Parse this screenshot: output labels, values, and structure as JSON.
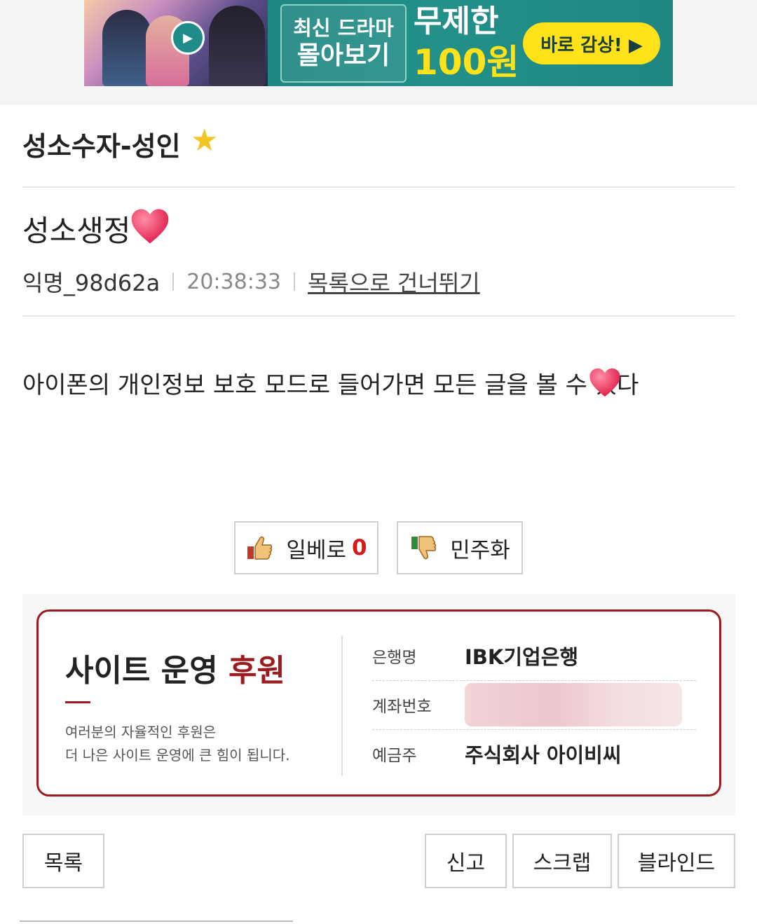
{
  "banner": {
    "line1": "최신 드라마",
    "line2": "몰아보기",
    "headline": "무제한",
    "price": "100원",
    "cta": "바로 감상! ▶"
  },
  "board": {
    "title": "성소수자-성인",
    "star_icon": "star-icon"
  },
  "post": {
    "title": "성소생정",
    "author": "익명_98d62a",
    "time": "20:38:33",
    "skip_link": "목록으로 건너뛰기",
    "body": "아이폰의 개인정보 보호 모드로 들어가면 모든 글을 볼 수 있다"
  },
  "votes": {
    "up_label": "일베로",
    "up_count": "0",
    "down_label": "민주화"
  },
  "support": {
    "title_main": "사이트 운영",
    "title_accent": "후원",
    "desc_line1": "여러분의 자율적인 후원은",
    "desc_line2": "더 나은 사이트 운영에 큰 힘이 됩니다.",
    "bank_label": "은행명",
    "bank_value": "IBK기업은행",
    "account_label": "계좌번호",
    "holder_label": "예금주",
    "holder_value": "주식회사 아이비씨"
  },
  "actions": {
    "list": "목록",
    "report": "신고",
    "scrap": "스크랩",
    "blind": "블라인드"
  },
  "colors": {
    "accent": "#9b1b1f",
    "vote_count": "#d01c1c",
    "banner_bg": "#1f8580",
    "banner_yellow": "#ffe21a"
  }
}
